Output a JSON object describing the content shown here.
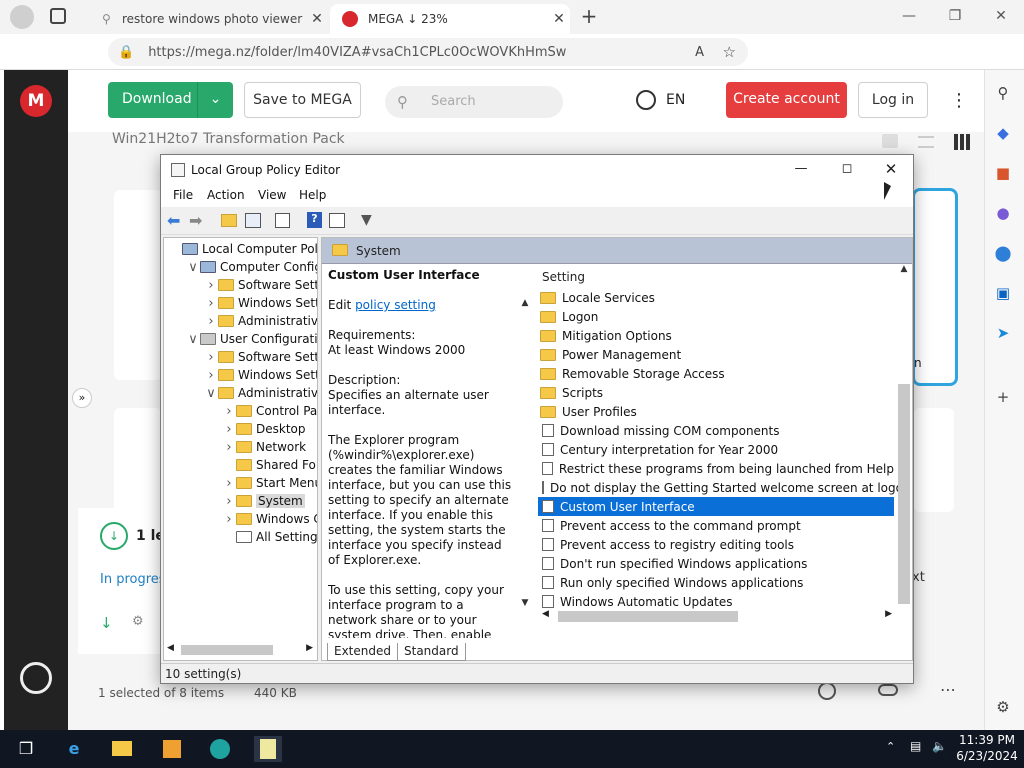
{
  "browser": {
    "tabs": [
      {
        "title": "restore windows photo viewer d",
        "active": false
      },
      {
        "title": "MEGA ↓ 23%",
        "active": true
      }
    ],
    "url": "https://mega.nz/folder/lm40VIZA#vsaCh1CPLc0OcWOVKhHmSw",
    "new_tab": "+"
  },
  "mega": {
    "logo": "M",
    "download_label": "Download",
    "save_label": "Save to MEGA",
    "search_placeholder": "Search",
    "language": "EN",
    "create_account": "Create account",
    "login": "Log in",
    "folder_title": "Win21H2to7 Transformation Pack",
    "transfer_count": "1 le",
    "in_progress": "In progres",
    "selection_status": "1 selected of 8 items",
    "selection_size": "440 KB",
    "partial_text": "xt",
    "partial_text2": "n"
  },
  "gpedit": {
    "title": "Local Group Policy Editor",
    "menu": [
      "File",
      "Action",
      "View",
      "Help"
    ],
    "tree": [
      {
        "label": "Local Computer Policy",
        "indent": 0,
        "exp": "",
        "icon": "computer"
      },
      {
        "label": "Computer Configura",
        "indent": 1,
        "exp": "v",
        "icon": "computer"
      },
      {
        "label": "Software Settings",
        "indent": 2,
        "exp": ">",
        "icon": "folder"
      },
      {
        "label": "Windows Setting",
        "indent": 2,
        "exp": ">",
        "icon": "folder"
      },
      {
        "label": "Administrative Te",
        "indent": 2,
        "exp": ">",
        "icon": "folder"
      },
      {
        "label": "User Configuration",
        "indent": 1,
        "exp": "v",
        "icon": "user"
      },
      {
        "label": "Software Settings",
        "indent": 2,
        "exp": ">",
        "icon": "folder"
      },
      {
        "label": "Windows Setting",
        "indent": 2,
        "exp": ">",
        "icon": "folder"
      },
      {
        "label": "Administrative Te",
        "indent": 2,
        "exp": "v",
        "icon": "folder"
      },
      {
        "label": "Control Panel",
        "indent": 3,
        "exp": ">",
        "icon": "folder"
      },
      {
        "label": "Desktop",
        "indent": 3,
        "exp": ">",
        "icon": "folder"
      },
      {
        "label": "Network",
        "indent": 3,
        "exp": ">",
        "icon": "folder"
      },
      {
        "label": "Shared Folder",
        "indent": 3,
        "exp": "",
        "icon": "folder"
      },
      {
        "label": "Start Menu ar",
        "indent": 3,
        "exp": ">",
        "icon": "folder"
      },
      {
        "label": "System",
        "indent": 3,
        "exp": ">",
        "icon": "folder",
        "selected": true
      },
      {
        "label": "Windows Cor",
        "indent": 3,
        "exp": ">",
        "icon": "folder"
      },
      {
        "label": "All Settings",
        "indent": 3,
        "exp": "",
        "icon": "settings"
      }
    ],
    "header_folder": "System",
    "policy_title": "Custom User Interface",
    "edit_prefix": "Edit ",
    "edit_link": "policy setting",
    "requirements": "Requirements:\nAt least Windows 2000",
    "description": "Description:\nSpecifies an alternate user interface.",
    "desc_para": "The Explorer program (%windir%\\explorer.exe) creates the familiar Windows interface, but you can use this setting to specify an alternate interface. If you enable this setting, the system starts the interface you specify instead of Explorer.exe.",
    "desc_para2": "To use this setting, copy your interface program to a network share or to your system drive. Then, enable this setting, and type the name of the interface",
    "column_header": "Setting",
    "settings": [
      {
        "label": "Locale Services",
        "type": "folder"
      },
      {
        "label": "Logon",
        "type": "folder"
      },
      {
        "label": "Mitigation Options",
        "type": "folder"
      },
      {
        "label": "Power Management",
        "type": "folder"
      },
      {
        "label": "Removable Storage Access",
        "type": "folder"
      },
      {
        "label": "Scripts",
        "type": "folder"
      },
      {
        "label": "User Profiles",
        "type": "folder"
      },
      {
        "label": "Download missing COM components",
        "type": "policy"
      },
      {
        "label": "Century interpretation for Year 2000",
        "type": "policy"
      },
      {
        "label": "Restrict these programs from being launched from Help",
        "type": "policy"
      },
      {
        "label": "Do not display the Getting Started welcome screen at logon",
        "type": "policy"
      },
      {
        "label": "Custom User Interface",
        "type": "policy",
        "selected": true
      },
      {
        "label": "Prevent access to the command prompt",
        "type": "policy"
      },
      {
        "label": "Prevent access to registry editing tools",
        "type": "policy"
      },
      {
        "label": "Don't run specified Windows applications",
        "type": "policy"
      },
      {
        "label": "Run only specified Windows applications",
        "type": "policy"
      },
      {
        "label": "Windows Automatic Updates",
        "type": "policy"
      }
    ],
    "tab_extended": "Extended",
    "tab_standard": "Standard",
    "status": "10 setting(s)"
  },
  "taskbar": {
    "time": "11:39 PM",
    "date": "6/23/2024"
  },
  "colors": {
    "mega_red": "#d9272e",
    "download_green": "#28a96b",
    "create_red": "#e63e3e",
    "selection_blue": "#0a6fd6",
    "taskbar": "#101622"
  }
}
